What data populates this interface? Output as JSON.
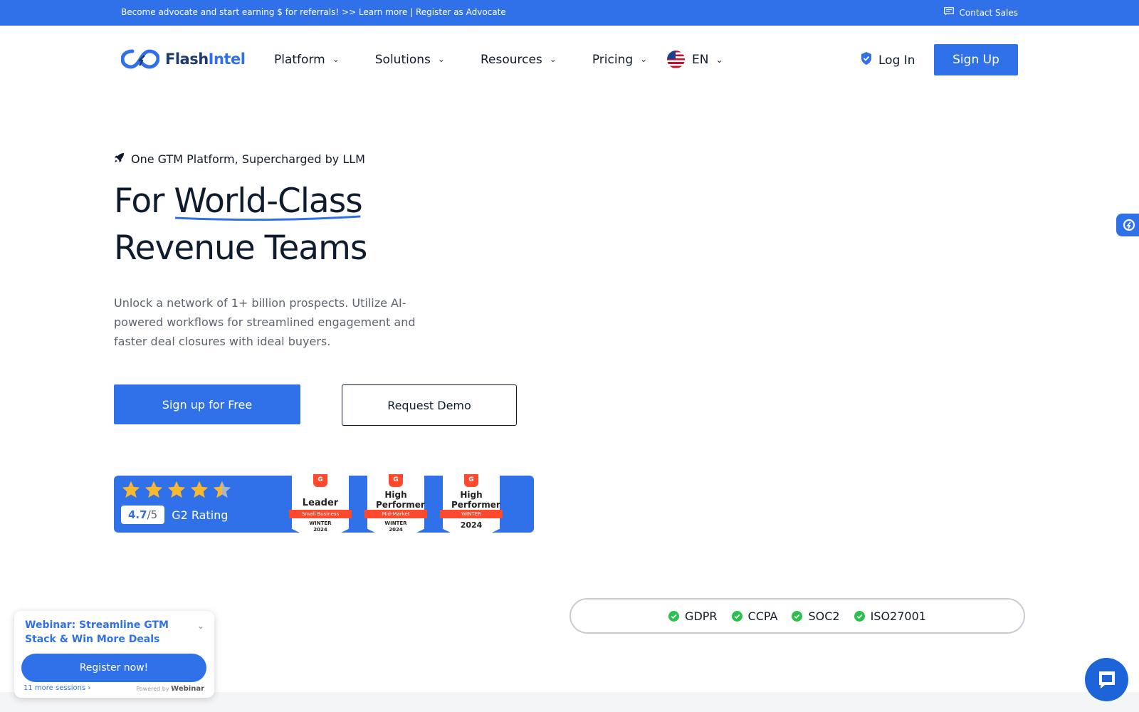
{
  "topbar": {
    "promo": "Become advocate and start earning $ for referrals! >> Learn more | Register as Advocate",
    "contact": "Contact Sales"
  },
  "brand": {
    "name_dark": "Flash",
    "name_accent": "Intel",
    "accent_color": "#3070e8"
  },
  "nav": {
    "items": [
      {
        "label": "Platform"
      },
      {
        "label": "Solutions"
      },
      {
        "label": "Resources"
      },
      {
        "label": "Pricing"
      }
    ],
    "language": "EN",
    "login": "Log In",
    "signup": "Sign Up"
  },
  "hero": {
    "tagline": "One GTM Platform, Supercharged by LLM",
    "headline_prefix": "For ",
    "headline_underlined": "World-Class",
    "headline_line2": "Revenue Teams",
    "description": "Unlock a network of 1+ billion prospects. Utilize AI-powered workflows for streamlined engagement and faster deal closures with ideal buyers.",
    "cta_primary": "Sign up for Free",
    "cta_secondary": "Request Demo"
  },
  "g2": {
    "stars": 4.5,
    "score": "4.7",
    "score_suffix": "/5",
    "label": "G2 Rating",
    "badges": [
      {
        "title": "Leader",
        "segment": "Small Business",
        "season": "WINTER",
        "year": "2024"
      },
      {
        "title": "High Performer",
        "segment": "Mid-Market",
        "season": "WINTER",
        "year": "2024"
      },
      {
        "title": "High Performer",
        "segment": "WINTER",
        "season": "",
        "year": "2024"
      }
    ]
  },
  "compliance": [
    "GDPR",
    "CCPA",
    "SOC2",
    "ISO27001"
  ],
  "webinar": {
    "title": "Webinar: Streamline GTM Stack & Win More Deals",
    "register": "Register now!",
    "more_sessions": "11 more sessions ›",
    "powered_by": "Powered by",
    "powered_brand": "Webinar"
  }
}
